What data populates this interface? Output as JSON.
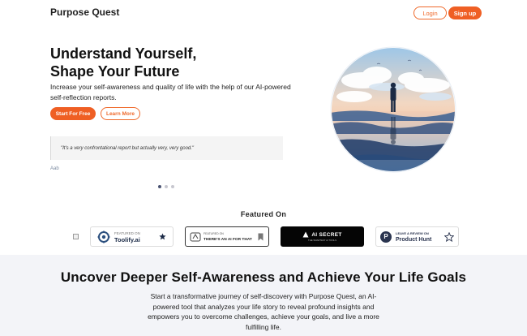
{
  "header": {
    "brand": "Purpose Quest",
    "login_label": "Login",
    "signup_label": "Sign up"
  },
  "hero": {
    "title_line1": "Understand Yourself,",
    "title_line2": "Shape Your Future",
    "subtitle": "Increase your self-awareness and quality of life with the help of our AI-powered self-reflection reports.",
    "start_label": "Start For Free",
    "learn_label": "Learn More",
    "testimonial_quote": "\"It's a very confrontational report but actually very, very good.\"",
    "testimonial_author": "Aab",
    "carousel_dots": 3,
    "carousel_active": 1
  },
  "featured": {
    "title": "Featured On",
    "toolify": {
      "top": "FEATURED ON",
      "name": "Toolify.ai"
    },
    "aiforthat": {
      "top": "FEATURED ON",
      "name": "THERE'S AN AI FOR THAT"
    },
    "aisecret": {
      "name": "AI SECRET",
      "tagline": "THE SMARTEST AI TOOLS"
    },
    "producthunt": {
      "top": "LEAVE A REVIEW ON",
      "name": "Product Hunt"
    }
  },
  "section": {
    "title": "Uncover Deeper Self-Awareness and Achieve Your Life Goals",
    "body": "Start a transformative journey of self-discovery with Purpose Quest, an AI-powered tool that analyzes your life story to reveal profound insights and empowers you to overcome challenges, achieve your goals, and live a more fulfilling life."
  },
  "colors": {
    "accent": "#ef5f24",
    "dark_text": "#111111",
    "muted_bg": "#f3f4f8"
  }
}
